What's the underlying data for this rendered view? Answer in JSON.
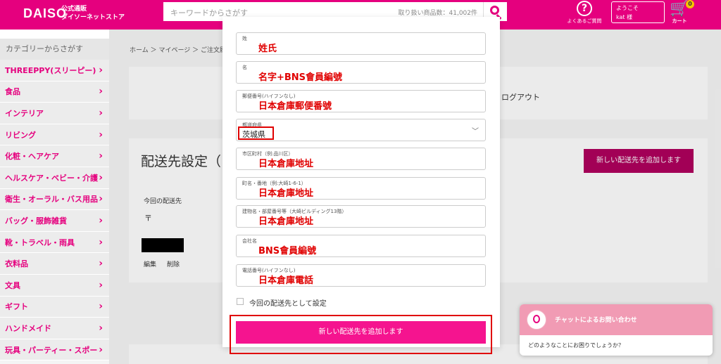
{
  "header": {
    "logo": "DAISO",
    "logo_sub_1": "公式通販",
    "logo_sub_2": "ダイソーネットストア",
    "search_placeholder": "キーワードからさがす",
    "search_count": "取り扱い商品数：41,002件",
    "faq_icon": "?",
    "faq_label": "よくあるご質問",
    "welcome_1": "ようこそ",
    "welcome_2": "kat  様",
    "cart_badge": "0",
    "cart_label": "カート",
    "brand_color": "#e5007e"
  },
  "sidebar": {
    "heading": "カテゴリーからさがす",
    "items": [
      {
        "label": "THREEPPY(スリーピー)"
      },
      {
        "label": "食品"
      },
      {
        "label": "インテリア"
      },
      {
        "label": "リビング"
      },
      {
        "label": "化粧・ヘアケア"
      },
      {
        "label": "ヘルスケア・ベビー・介護"
      },
      {
        "label": "衛生・オーラル・バス用品"
      },
      {
        "label": "バッグ・服飾雑貨"
      },
      {
        "label": "靴・トラベル・雨具"
      },
      {
        "label": "衣料品"
      },
      {
        "label": "文具"
      },
      {
        "label": "ギフト"
      },
      {
        "label": "ハンドメイド"
      },
      {
        "label": "玩具・パーティー・スポー"
      }
    ]
  },
  "page": {
    "breadcrumb": "ホーム ＞ マイページ ＞ ご注文履",
    "logout": "ログアウト",
    "shipping_title": "配送先設定（",
    "add_button": "新しい配送先を追加します",
    "current_label": "今回の配送先",
    "postal_mark": "〒",
    "edit": "編集",
    "delete": "削除"
  },
  "modal": {
    "fields": [
      {
        "label": "姓",
        "value": "姓氏"
      },
      {
        "label": "名",
        "value": "名字+BNS會員編號"
      },
      {
        "label": "郵便番号(ハイフンなし)",
        "value": "日本倉庫郵便番號"
      },
      {
        "label": "都道府県",
        "value": "茨城県"
      },
      {
        "label": "市区町村（例:品川区）",
        "value": "日本倉庫地址"
      },
      {
        "label": "町名・番地（例:大崎1-6-1）",
        "value": "日本倉庫地址"
      },
      {
        "label": "建物名・部屋番号等（大崎ビルディング13階）",
        "value": "日本倉庫地址"
      },
      {
        "label": "会社名",
        "value": "BNS會員編號"
      },
      {
        "label": "電話番号(ハイフンなし)",
        "value": "日本倉庫電話"
      }
    ],
    "checkbox_label": "今回の配送先として設定",
    "submit": "新しい配送先を追加します",
    "submit_color": "#f5148f",
    "annotation_color": "#e00000"
  },
  "chat": {
    "title": "チャットによるお問い合わせ",
    "message": "どのようなことにお困りでしょうか？"
  }
}
